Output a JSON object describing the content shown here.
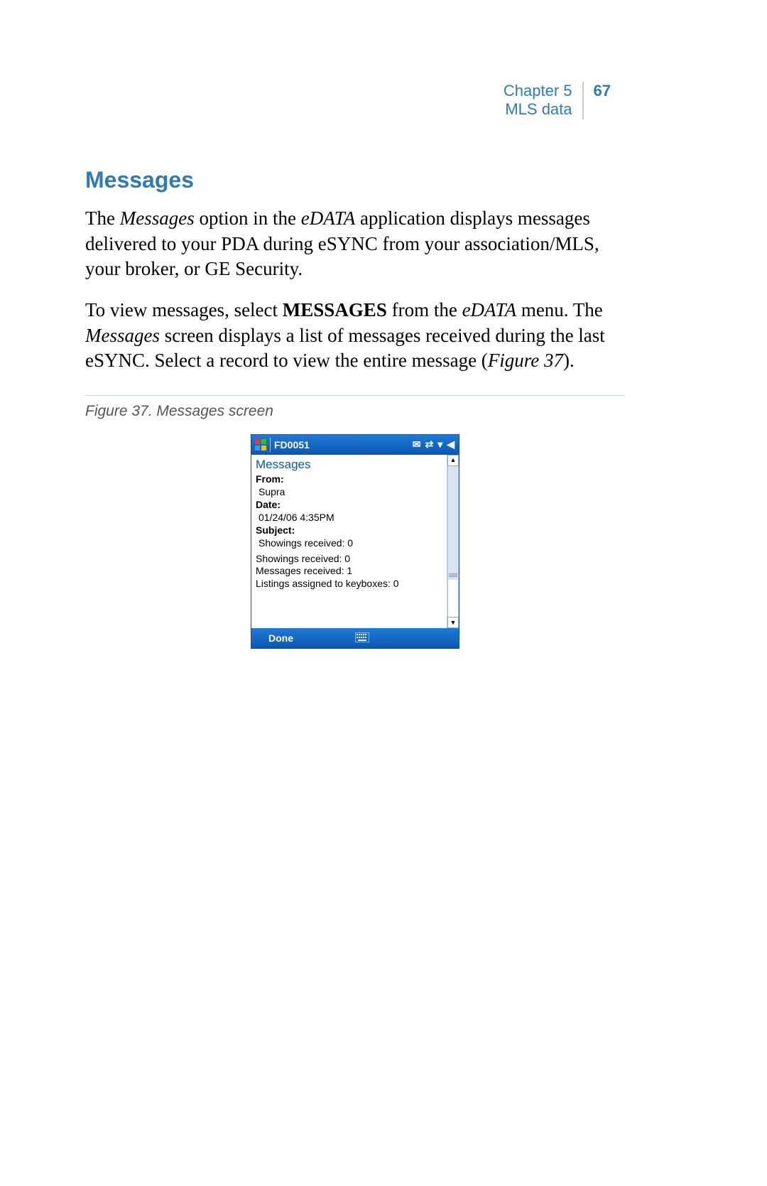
{
  "header": {
    "chapter": "Chapter 5",
    "subtitle": "MLS data",
    "page_number": "67"
  },
  "section": {
    "heading": "Messages",
    "para1_pre": "The ",
    "para1_i1": "Messages",
    "para1_mid1": " option in the ",
    "para1_i2": "eDATA",
    "para1_post": " application displays messages delivered to your PDA during eSYNC from your association/MLS, your broker, or GE Security.",
    "para2_pre": "To view messages, select ",
    "para2_b1": "MESSAGES",
    "para2_mid1": " from the ",
    "para2_i1": "eDATA",
    "para2_mid2": " menu. The ",
    "para2_i2": "Messages",
    "para2_mid3": " screen displays a list of messages received during the last eSYNC.  Select a record to view the entire message (",
    "para2_i3": "Figure 37",
    "para2_post": ")."
  },
  "figure": {
    "caption": "Figure 37.  Messages screen"
  },
  "pda": {
    "title": "FD0051",
    "screen_title": "Messages",
    "from_label": "From:",
    "from_value": "Supra",
    "date_label": "Date:",
    "date_value": "01/24/06 4:35PM",
    "subject_label": "Subject:",
    "subject_value": "Showings received: 0",
    "body_line1": "Showings received: 0",
    "body_line2": "Messages received: 1",
    "body_line3": "Listings assigned to keyboxes: 0",
    "done_label": "Done",
    "scroll_up": "▲",
    "scroll_down": "▼",
    "icon_envelope": "✉",
    "icon_sync": "⇄",
    "icon_signal": "▾",
    "icon_sound": "◀"
  }
}
